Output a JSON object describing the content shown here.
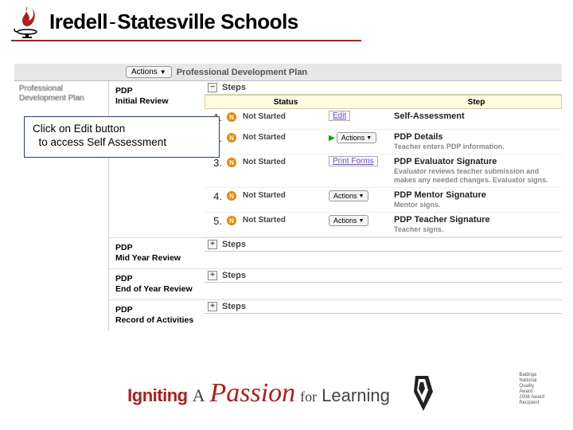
{
  "header": {
    "org_name_1": "Iredell",
    "dash": "-",
    "org_name_2": "Statesville Schools"
  },
  "toolbar": {
    "actions_label": "Actions",
    "breadcrumb": "Professional Development Plan"
  },
  "sidebar": {
    "title_line1": "Professional",
    "title_line2": "Development Plan"
  },
  "callout": {
    "line1": "Click on Edit button",
    "line2": "  to access Self Assessment"
  },
  "steps_header_label": "Steps",
  "table_head": {
    "status": "Status",
    "step": "Step"
  },
  "status_not_started": "Not Started",
  "btn_actions": "Actions",
  "btn_edit": "Edit",
  "btn_print_forms": "Print Forms",
  "sections": [
    {
      "title_line1": "PDP",
      "title_line2": "Initial Review",
      "expanded": true,
      "collapse_glyph": "−",
      "steps": [
        {
          "num": "1.",
          "action_type": "edit",
          "title": "Self-Assessment",
          "desc": ""
        },
        {
          "num": "2.",
          "action_type": "actions",
          "green_arrow": true,
          "title": "PDP Details",
          "desc": "Teacher enters PDP information."
        },
        {
          "num": "3.",
          "action_type": "print",
          "title": "PDP Evaluator Signature",
          "desc": "Evaluator reviews teacher submission and makes any needed changes. Evaluator signs."
        },
        {
          "num": "4.",
          "action_type": "actions",
          "title": "PDP Mentor Signature",
          "desc": "Mentor signs."
        },
        {
          "num": "5.",
          "action_type": "actions",
          "title": "PDP Teacher Signature",
          "desc": "Teacher signs."
        }
      ]
    },
    {
      "title_line1": "PDP",
      "title_line2": "Mid Year Review",
      "expanded": false,
      "collapse_glyph": "+"
    },
    {
      "title_line1": "PDP",
      "title_line2": "End of Year Review",
      "expanded": false,
      "collapse_glyph": "+"
    },
    {
      "title_line1": "PDP",
      "title_line2": "Record of Activities",
      "expanded": false,
      "collapse_glyph": "+"
    }
  ],
  "footer": {
    "igniting": "Igniting",
    "a": "A",
    "passion": "Passion",
    "for": "for",
    "learning": "Learning",
    "award_line1": "Baldrige",
    "award_line2": "National",
    "award_line3": "Quality",
    "award_line4": "Award",
    "award_line5": "2008 Award",
    "award_line6": "Recipient"
  }
}
